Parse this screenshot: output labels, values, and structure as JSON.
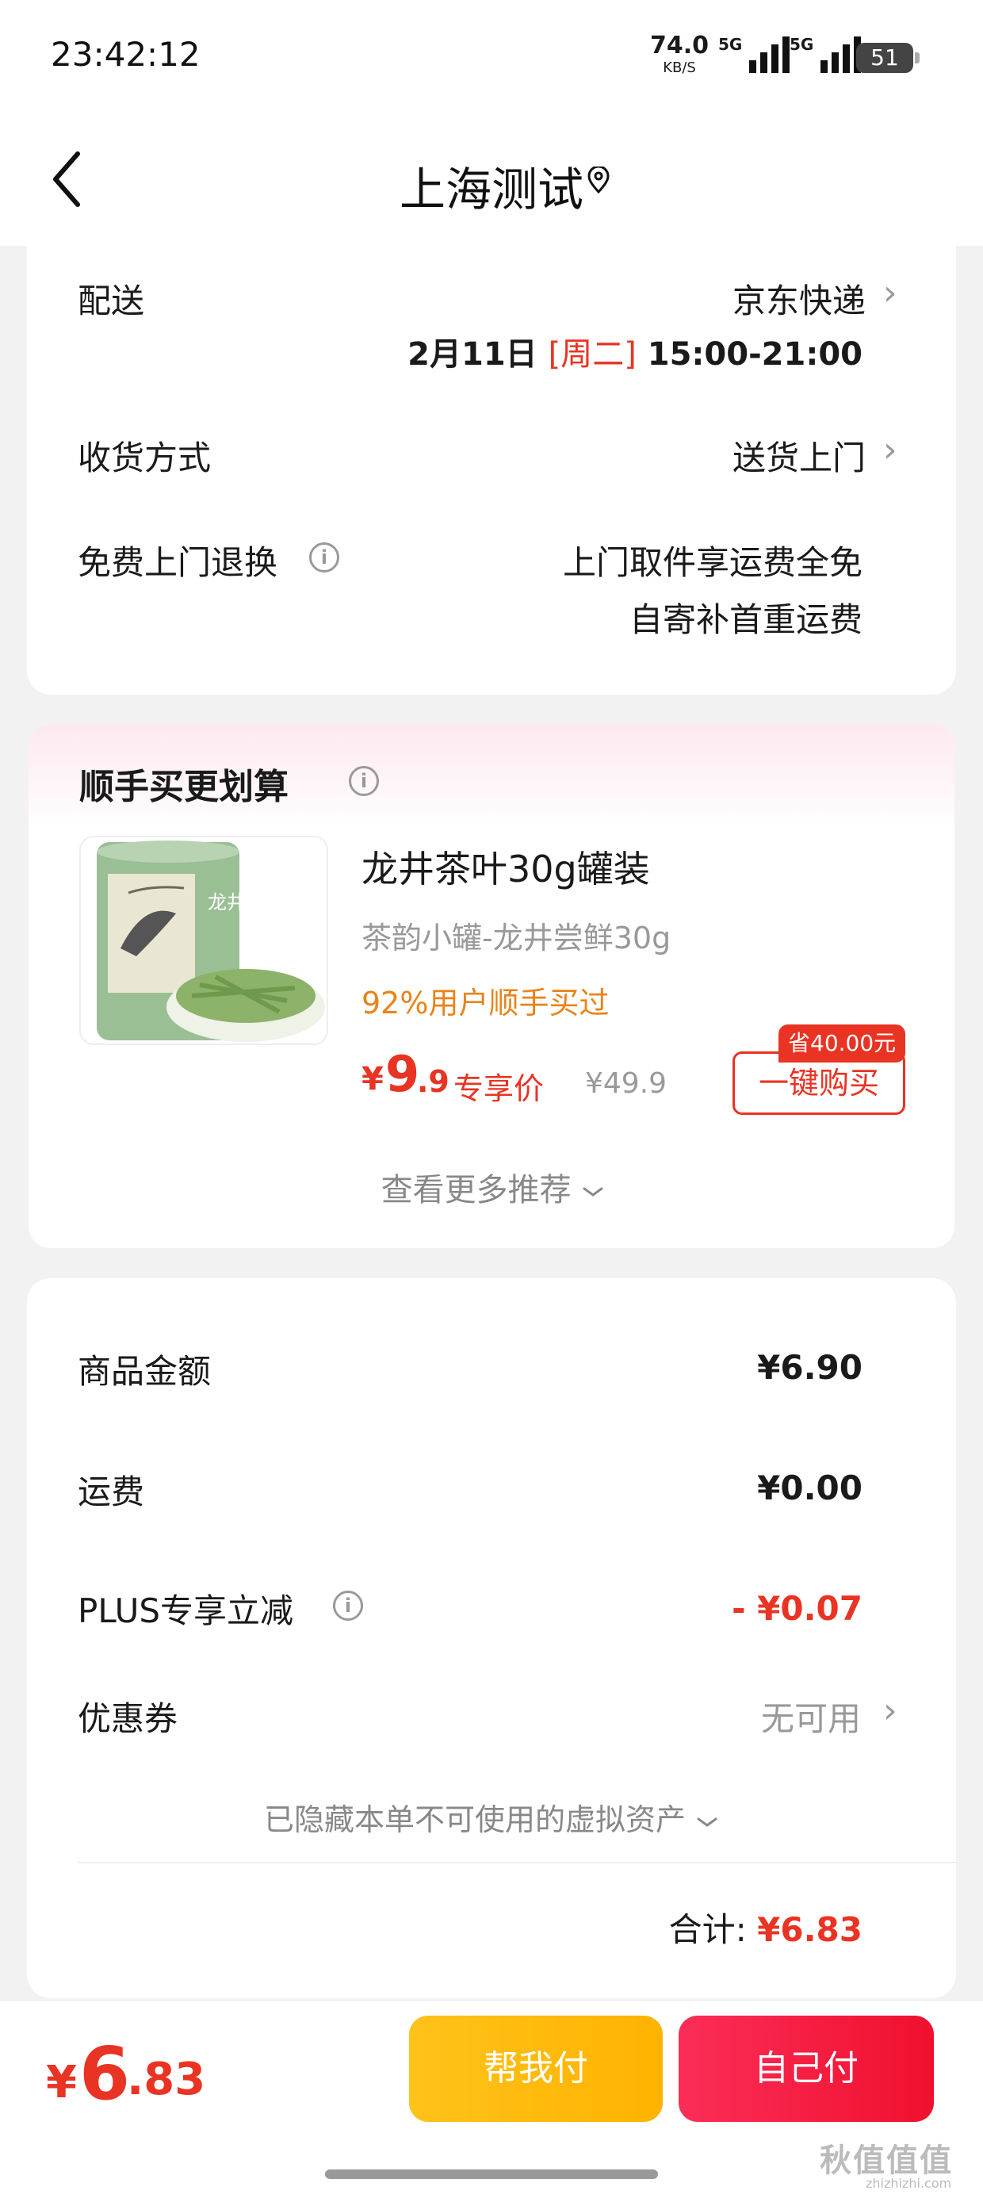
{
  "status": {
    "time": "23:42:12",
    "net_speed": "74.0",
    "net_unit": "KB/S",
    "sim1": "5G",
    "sim2": "5G",
    "battery": "51"
  },
  "header": {
    "title": "上海测试",
    "back_icon": "chevron-left-icon",
    "location_icon": "location-pin-icon"
  },
  "delivery": {
    "label": "配送",
    "carrier": "京东快递",
    "date": "2月11日",
    "weekday": "[周二]",
    "time_window": "15:00-21:00"
  },
  "receive": {
    "label": "收货方式",
    "value": "送货上门"
  },
  "returns": {
    "label": "免费上门退换",
    "line1": "上门取件享运费全免",
    "line2": "自寄补首重运费"
  },
  "recommend": {
    "title": "顺手买更划算",
    "product": {
      "name": "龙井茶叶30g罐装",
      "subtitle": "茶韵小罐-龙井尝鲜30g",
      "buyers": "92%用户顺手买过",
      "yen": "¥",
      "price_int": "9",
      "price_dec": ".9",
      "price_tag": "专享价",
      "original_price": "¥49.9",
      "save_badge": "省40.00元",
      "buy_label": "一键购买",
      "image_label": "龙井"
    },
    "more": "查看更多推荐"
  },
  "summary": {
    "goods_label": "商品金额",
    "goods_value": "¥6.90",
    "shipping_label": "运费",
    "shipping_value": "¥0.00",
    "plus_label": "PLUS专享立减",
    "plus_value": "- ¥0.07",
    "coupon_label": "优惠券",
    "coupon_value": "无可用",
    "hidden_assets": "已隐藏本单不可使用的虚拟资产",
    "total_label": "合计:",
    "total_value": "¥6.83"
  },
  "bottom": {
    "yen": "¥",
    "total_int": "6",
    "total_dec": ".83",
    "help_pay": "帮我付",
    "self_pay": "自己付",
    "watermark": "秋值值值",
    "watermark_sub": "zhizhizhi.com"
  },
  "colors": {
    "accent_red": "#e93323",
    "orange": "#e8841a",
    "yellow_btn": "#ffb300",
    "red_btn": "#f0102e"
  }
}
